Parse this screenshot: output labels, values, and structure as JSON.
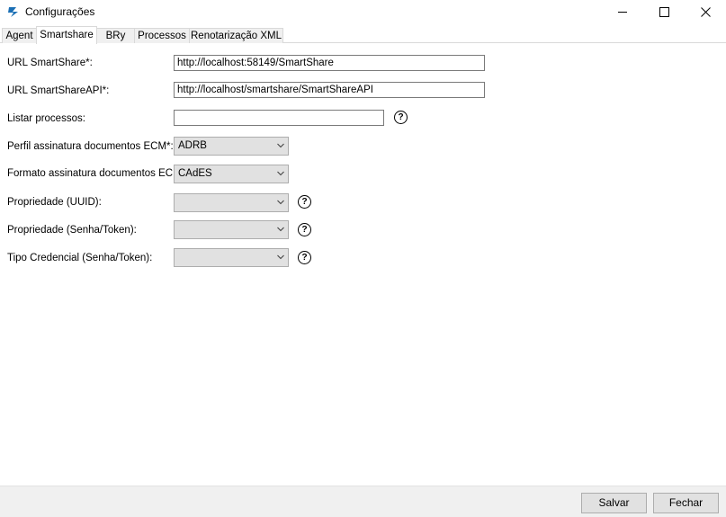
{
  "window": {
    "title": "Configurações",
    "icon": "smartshare-logo-icon",
    "controls": [
      "minimize-icon",
      "maximize-icon",
      "close-icon"
    ]
  },
  "tabs": [
    {
      "label": "Agent",
      "active": false
    },
    {
      "label": "Smartshare",
      "active": true
    },
    {
      "label": "BRy",
      "active": false
    },
    {
      "label": "Processos",
      "active": false
    },
    {
      "label": "Renotarização XML",
      "active": false
    }
  ],
  "form": {
    "url_smartshare": {
      "label": "URL SmartShare*:",
      "value": "http://localhost:58149/SmartShare"
    },
    "url_smartshare_api": {
      "label": "URL SmartShareAPI*:",
      "value": "http://localhost/smartshare/SmartShareAPI"
    },
    "listar_processos": {
      "label": "Listar processos:",
      "value": ""
    },
    "perfil_assinatura": {
      "label": "Perfil assinatura documentos ECM*:",
      "value": "ADRB"
    },
    "formato_assinatura": {
      "label": "Formato assinatura documentos ECM:",
      "value": "CAdES"
    },
    "propriedade_uuid": {
      "label": "Propriedade (UUID):",
      "value": ""
    },
    "propriedade_senha": {
      "label": "Propriedade (Senha/Token):",
      "value": ""
    },
    "tipo_credencial": {
      "label": "Tipo Credencial (Senha/Token):",
      "value": ""
    },
    "help_symbol": "?"
  },
  "footer": {
    "save_label": "Salvar",
    "close_label": "Fechar"
  },
  "colors": {
    "accent": "#1a6fb5",
    "button_bg": "#e1e1e1",
    "footer_bg": "#f0f0f0"
  }
}
